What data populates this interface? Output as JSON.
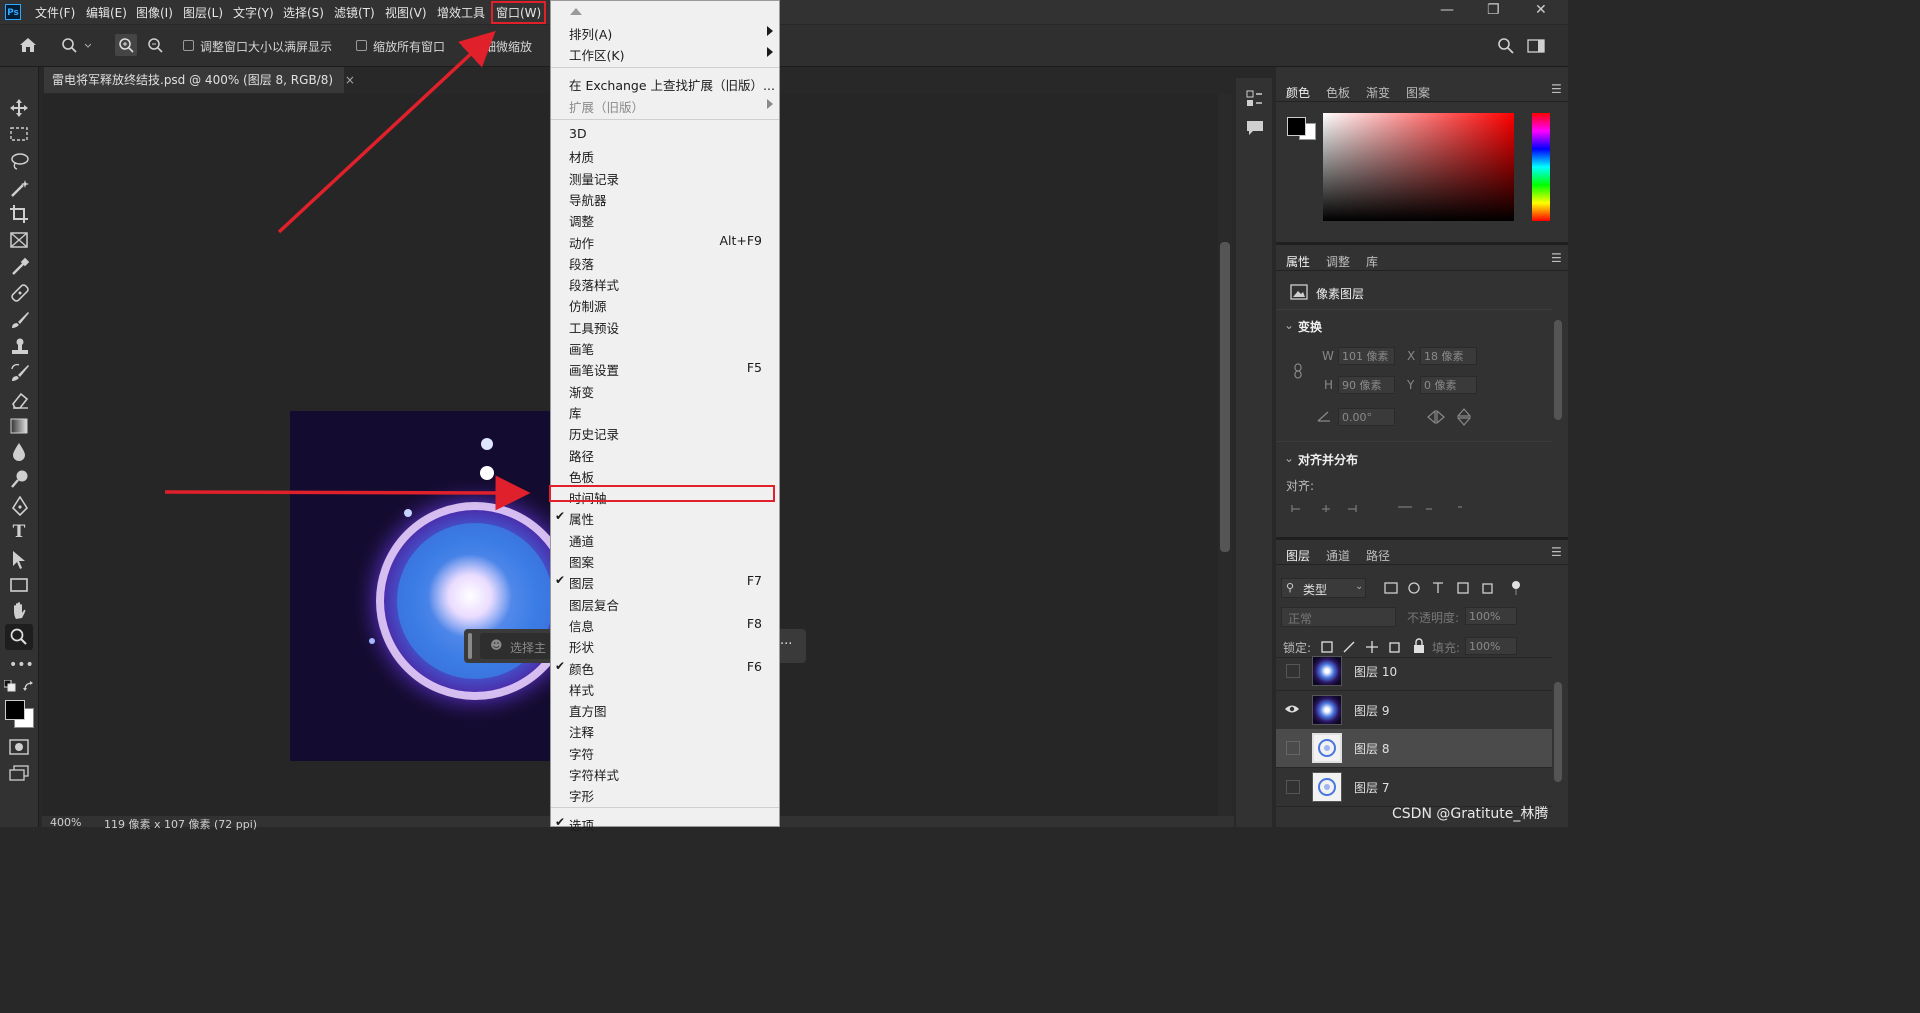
{
  "app": {
    "logo": "Ps"
  },
  "menubar": {
    "items": [
      "文件(F)",
      "编辑(E)",
      "图像(I)",
      "图层(L)",
      "文字(Y)",
      "选择(S)",
      "滤镜(T)",
      "视图(V)",
      "增效工具",
      "窗口(W)"
    ],
    "window_controls": [
      "—",
      "❐",
      "✕"
    ]
  },
  "options": {
    "resize_label": "调整窗口大小以满屏显示",
    "zoom_all_label": "缩放所有窗口",
    "scrubby_label": "细微缩放",
    "scrubby_checked": true
  },
  "document": {
    "tab_title": "雷电将军释放终结技.psd @ 400% (图层 8, RGB/8)",
    "close": "×"
  },
  "overlay": {
    "subject_placeholder": "选择主",
    "more": "···"
  },
  "status": {
    "zoom": "400%",
    "info": "119 像素 x 107 像素 (72 ppi)"
  },
  "window_menu": {
    "arrange": "排列(A)",
    "workspace": "工作区(K)",
    "exchange": "在 Exchange 上查找扩展（旧版）...",
    "extensions": "扩展（旧版）",
    "items": [
      {
        "label": "3D",
        "shortcut": "",
        "checked": false
      },
      {
        "label": "材质",
        "shortcut": "",
        "checked": false
      },
      {
        "label": "测量记录",
        "shortcut": "",
        "checked": false
      },
      {
        "label": "导航器",
        "shortcut": "",
        "checked": false
      },
      {
        "label": "调整",
        "shortcut": "",
        "checked": false
      },
      {
        "label": "动作",
        "shortcut": "Alt+F9",
        "checked": false
      },
      {
        "label": "段落",
        "shortcut": "",
        "checked": false
      },
      {
        "label": "段落样式",
        "shortcut": "",
        "checked": false
      },
      {
        "label": "仿制源",
        "shortcut": "",
        "checked": false
      },
      {
        "label": "工具预设",
        "shortcut": "",
        "checked": false
      },
      {
        "label": "画笔",
        "shortcut": "",
        "checked": false
      },
      {
        "label": "画笔设置",
        "shortcut": "F5",
        "checked": false
      },
      {
        "label": "渐变",
        "shortcut": "",
        "checked": false
      },
      {
        "label": "库",
        "shortcut": "",
        "checked": false
      },
      {
        "label": "历史记录",
        "shortcut": "",
        "checked": false
      },
      {
        "label": "路径",
        "shortcut": "",
        "checked": false
      },
      {
        "label": "色板",
        "shortcut": "",
        "checked": false
      },
      {
        "label": "时间轴",
        "shortcut": "",
        "checked": false
      },
      {
        "label": "属性",
        "shortcut": "",
        "checked": true
      },
      {
        "label": "通道",
        "shortcut": "",
        "checked": false
      },
      {
        "label": "图案",
        "shortcut": "",
        "checked": false
      },
      {
        "label": "图层",
        "shortcut": "F7",
        "checked": true
      },
      {
        "label": "图层复合",
        "shortcut": "",
        "checked": false
      },
      {
        "label": "信息",
        "shortcut": "F8",
        "checked": false
      },
      {
        "label": "形状",
        "shortcut": "",
        "checked": false
      },
      {
        "label": "颜色",
        "shortcut": "F6",
        "checked": true
      },
      {
        "label": "样式",
        "shortcut": "",
        "checked": false
      },
      {
        "label": "直方图",
        "shortcut": "",
        "checked": false
      },
      {
        "label": "注释",
        "shortcut": "",
        "checked": false
      },
      {
        "label": "字符",
        "shortcut": "",
        "checked": false
      },
      {
        "label": "字符样式",
        "shortcut": "",
        "checked": false
      },
      {
        "label": "字形",
        "shortcut": "",
        "checked": false
      }
    ],
    "options": {
      "label": "选项",
      "checked": true
    }
  },
  "color_panel": {
    "tabs": [
      "颜色",
      "色板",
      "渐变",
      "图案"
    ]
  },
  "properties_panel": {
    "tabs": [
      "属性",
      "调整",
      "库"
    ],
    "kind": "像素图层",
    "transform_title": "变换",
    "w_label": "W",
    "w_value": "101 像素",
    "x_label": "X",
    "x_value": "18 像素",
    "h_label": "H",
    "h_value": "90 像素",
    "y_label": "Y",
    "y_value": "0 像素",
    "angle_value": "0.00°",
    "align_title": "对齐并分布",
    "align_label": "对齐:"
  },
  "layers_panel": {
    "tabs": [
      "图层",
      "通道",
      "路径"
    ],
    "filter_kind": "类型",
    "blend_mode": "正常",
    "opacity_label": "不透明度:",
    "opacity_value": "100%",
    "lock_label": "锁定:",
    "fill_label": "填充:",
    "fill_value": "100%",
    "layers": [
      {
        "name": "图层 10",
        "visible": false,
        "selected": false
      },
      {
        "name": "图层 9",
        "visible": true,
        "selected": false
      },
      {
        "name": "图层 8",
        "visible": false,
        "selected": true
      },
      {
        "name": "图层 7",
        "visible": false,
        "selected": false
      }
    ]
  },
  "watermark": "CSDN @Gratitute_林腾",
  "colors": {
    "annotation_red": "#e0202a",
    "menu_bg": "#f0f0f0",
    "ui_dark": "#323232"
  }
}
